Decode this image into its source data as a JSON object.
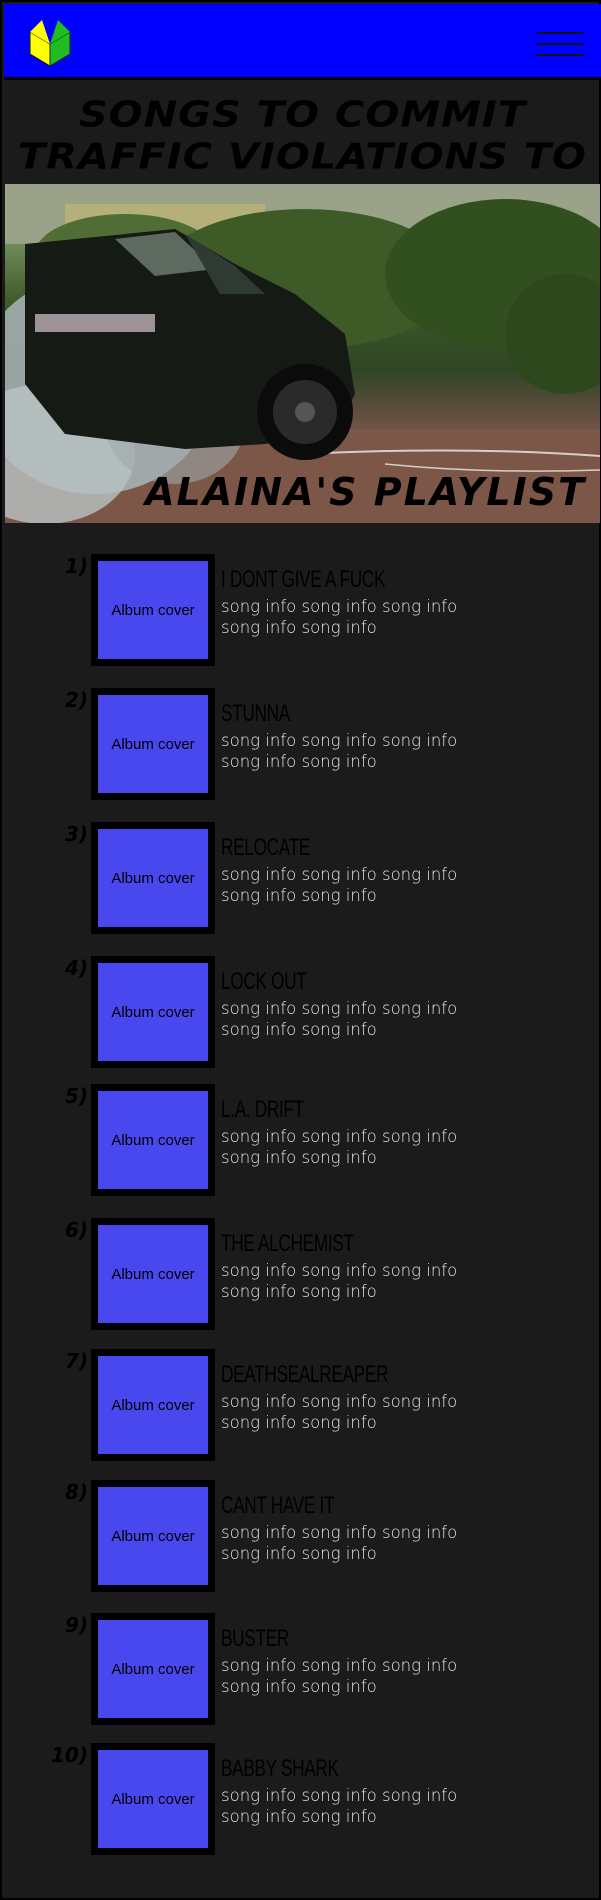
{
  "header": {
    "logo_icon": "shoshinsha-mark-icon",
    "menu_icon": "hamburger-menu-icon",
    "background_color": "#0000ff"
  },
  "page": {
    "title_line_1": "SONGS TO COMMIT",
    "title_line_2": "TRAFFIC VIOLATIONS TO",
    "playlist_label": "ALAINA'S PLAYLIST"
  },
  "songs": [
    {
      "num": "1)",
      "cover": "Album cover",
      "title": "I DONT GIVE A FUCK",
      "info": "song info song info song info song info song info"
    },
    {
      "num": "2)",
      "cover": "Album cover",
      "title": "STUNNA",
      "info": "song info song info song info song info song info"
    },
    {
      "num": "3)",
      "cover": "Album cover",
      "title": "RELOCATE",
      "info": "song info song info song info song info song info"
    },
    {
      "num": "4)",
      "cover": "Album cover",
      "title": "LOCK OUT",
      "info": "song info song info song info song info song info"
    },
    {
      "num": "5)",
      "cover": "Album cover",
      "title": "L.A. DRIFT",
      "info": "song info song info song info song info song info"
    },
    {
      "num": "6)",
      "cover": "Album cover",
      "title": "THE ALCHEMIST",
      "info": "song info song info song info song info song info"
    },
    {
      "num": "7)",
      "cover": "Album cover",
      "title": "DEATHSEALREAPER",
      "info": "song info song info song info song info song info"
    },
    {
      "num": "8)",
      "cover": "Album cover",
      "title": "CANT HAVE IT",
      "info": "song info song info song info song info song info"
    },
    {
      "num": "9)",
      "cover": "Album cover",
      "title": "BUSTER",
      "info": "song info song info song info song info song info"
    },
    {
      "num": "10)",
      "cover": "Album cover",
      "title": "BABBY SHARK",
      "info": "song info song info song info song info song info"
    }
  ]
}
